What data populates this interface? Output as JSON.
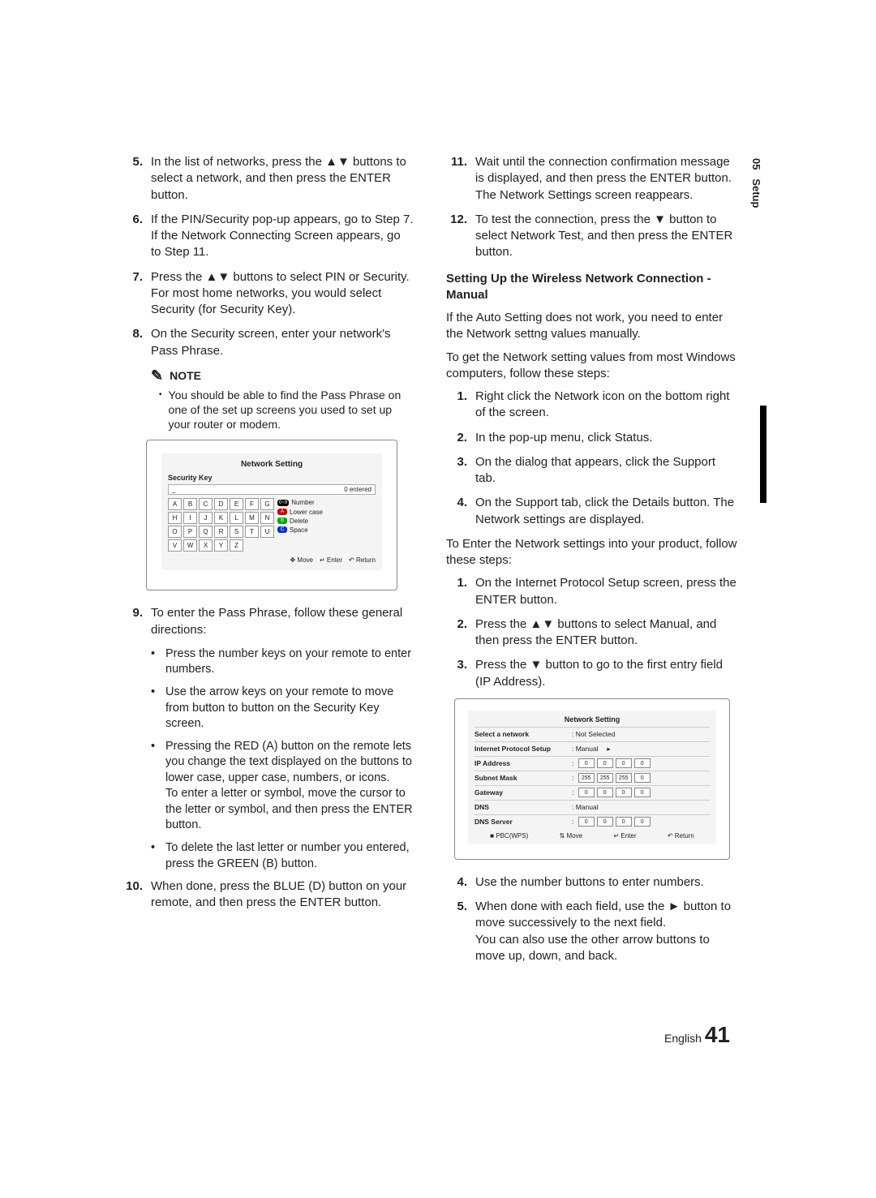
{
  "side": {
    "chapter": "05",
    "section": "Setup"
  },
  "pagefoot": {
    "lang": "English",
    "num": "41"
  },
  "left": {
    "s5": {
      "n": "5.",
      "t": "In the list of networks, press the ▲▼ buttons to select a network, and then press the ENTER button."
    },
    "s6": {
      "n": "6.",
      "t": "If the PIN/Security pop-up appears, go to Step 7. If the Network Connecting Screen appears, go to Step 11."
    },
    "s7": {
      "n": "7.",
      "t": "Press the ▲▼ buttons to select PIN or Security.\nFor most home networks, you would select Security (for Security Key)."
    },
    "s8": {
      "n": "8.",
      "t": "On the Security screen, enter your network's Pass Phrase."
    },
    "note_label": "NOTE",
    "note_body": "You should be able to find the Pass Phrase on one of the set up screens you used to set up your router or modem.",
    "fig1": {
      "title": "Network Setting",
      "keylabel": "Security Key",
      "entered": "0 entered",
      "rows": [
        [
          "A",
          "B",
          "C",
          "D",
          "E",
          "F",
          "G"
        ],
        [
          "H",
          "I",
          "J",
          "K",
          "L",
          "M",
          "N"
        ],
        [
          "O",
          "P",
          "Q",
          "R",
          "S",
          "T",
          "U"
        ],
        [
          "V",
          "W",
          "X",
          "Y",
          "Z"
        ]
      ],
      "legend": {
        "number": "Number",
        "lower": "Lower case",
        "delete": "Delete",
        "space": "Space",
        "a": "A",
        "b": "B",
        "c": "C"
      },
      "foot": {
        "move": "Move",
        "enter": "Enter",
        "return": "Return"
      }
    },
    "s9": {
      "n": "9.",
      "t": "To enter the Pass Phrase, follow these general directions:"
    },
    "s9b": {
      "b1": "Press the number keys on your remote to enter numbers.",
      "b2": "Use the arrow keys on your remote to move from button to button on the Security Key screen.",
      "b3": "Pressing the RED (A) button on the remote lets you change the text displayed on the buttons to lower case, upper case, numbers, or icons.\nTo enter a letter or symbol, move the cursor to the letter or symbol, and then press the ENTER button.",
      "b4": "To delete the last letter or number you entered, press the GREEN (B) button."
    },
    "s10": {
      "n": "10.",
      "t": "When done, press the BLUE (D) button on your remote, and then press the ENTER button."
    }
  },
  "right": {
    "s11": {
      "n": "11.",
      "t": "Wait until the connection confirmation message is displayed, and then press the ENTER button. The Network Settings screen reappears."
    },
    "s12": {
      "n": "12.",
      "t": "To test the connection, press the ▼ button to select Network Test, and then press the ENTER button."
    },
    "h_manual": "Setting Up the Wireless Network Connection - Manual",
    "p1": "If the Auto Setting does not work, you need to enter the Network settng values manually.",
    "p2": "To get the Network setting values from most Windows computers, follow these steps:",
    "a1": {
      "n": "1.",
      "t": "Right click the Network icon on the bottom right of the screen."
    },
    "a2": {
      "n": "2.",
      "t": "In the pop-up menu, click Status."
    },
    "a3": {
      "n": "3.",
      "t": "On the dialog that appears, click the Support tab."
    },
    "a4": {
      "n": "4.",
      "t": "On the Support tab, click the Details button. The Network settings are displayed."
    },
    "p3": "To Enter the Network settings into your product, follow these steps:",
    "b1": {
      "n": "1.",
      "t": "On the Internet Protocol Setup screen, press the ENTER button."
    },
    "b2": {
      "n": "2.",
      "t": "Press the ▲▼ buttons to select Manual, and then press the ENTER button."
    },
    "b3": {
      "n": "3.",
      "t": "Press the ▼ button to go to the first entry field (IP Address)."
    },
    "fig2": {
      "title": "Network Setting",
      "rows": {
        "r1l": "Select a network",
        "r1v": ": Not Selected",
        "r2l": "Internet Protocol Setup",
        "r2v": ": Manual",
        "r3l": "IP Address",
        "r3v": [
          "0",
          "0",
          "0",
          "0"
        ],
        "r4l": "Subnet Mask",
        "r4v": [
          "255",
          "255",
          "255",
          "0"
        ],
        "r5l": "Gateway",
        "r5v": [
          "0",
          "0",
          "0",
          "0"
        ],
        "r6l": "DNS",
        "r6v": ": Manual",
        "r7l": "DNS Server",
        "r7v": [
          "0",
          "0",
          "0",
          "0"
        ]
      },
      "foot": {
        "pbc": "PBC(WPS)",
        "move": "Move",
        "enter": "Enter",
        "return": "Return"
      }
    },
    "c4": {
      "n": "4.",
      "t": "Use the number buttons to enter numbers."
    },
    "c5": {
      "n": "5.",
      "t": "When done with each field, use the ► button to move successively to the next field.\nYou can also use the other arrow buttons to move up, down, and back."
    }
  }
}
